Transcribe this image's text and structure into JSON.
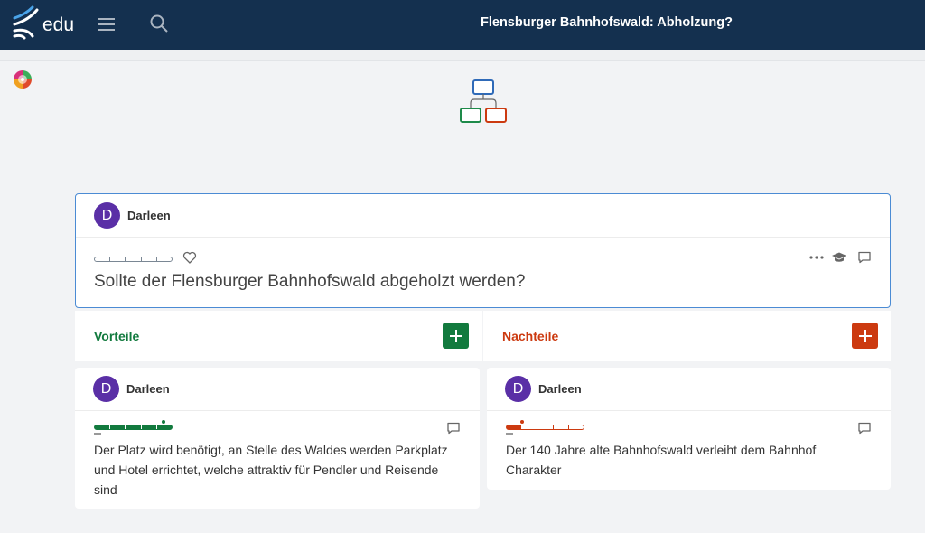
{
  "app": {
    "logo_text": "edu",
    "title": "Flensburger Bahnhofswald: Abholzung?"
  },
  "icons": {
    "logo": "edu-logo-icon",
    "menu": "hamburger-menu-icon",
    "search": "search-icon",
    "colors": "color-wheel-icon",
    "tree": "argument-tree-icon",
    "like": "heart-icon",
    "more": "more-dots-icon",
    "education": "graduation-cap-icon",
    "comment": "comment-icon",
    "add": "plus-icon"
  },
  "colors": {
    "header": "#14304f",
    "pro": "#127a3e",
    "con": "#cc3a10",
    "avatar": "#5a2fa6",
    "focus": "#4b8bd4"
  },
  "thesis": {
    "author_initial": "D",
    "author": "Darleen",
    "text": "Sollte der Flensburger Bahnhofswald abgeholzt werden?",
    "strength": 0
  },
  "columns": {
    "pro": {
      "label": "Vorteile"
    },
    "con": {
      "label": "Nachteile"
    }
  },
  "arguments": [
    {
      "side": "pro",
      "author_initial": "D",
      "author": "Darleen",
      "strength": 0.9,
      "text": "Der Platz wird benötigt, an Stelle des Waldes werden Parkplatz und Hotel errichtet, welche attraktiv für Pendler und Reisende sind"
    },
    {
      "side": "con",
      "author_initial": "D",
      "author": "Darleen",
      "strength": 0.2,
      "text": "Der 140 Jahre alte Bahnhofswald verleiht dem Bahnhof Charakter"
    }
  ]
}
